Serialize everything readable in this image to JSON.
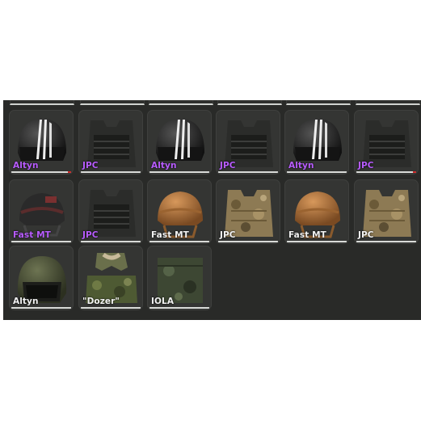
{
  "colors": {
    "rarity_purple": "#b85cff",
    "rarity_white": "#f2f2f2",
    "panel_bg": "#292a28",
    "slot_bg": "#343533"
  },
  "inventory": {
    "rows": [
      [
        {
          "label": "Altyn",
          "icon": "altyn-helmet-striped-icon",
          "rarity": "purple",
          "damaged": true
        },
        {
          "label": "JPC",
          "icon": "jpc-plate-carrier-black-icon",
          "rarity": "purple",
          "damaged": false
        },
        {
          "label": "Altyn",
          "icon": "altyn-helmet-striped-icon",
          "rarity": "purple",
          "damaged": false
        },
        {
          "label": "JPC",
          "icon": "jpc-plate-carrier-black-icon",
          "rarity": "purple",
          "damaged": false
        },
        {
          "label": "Altyn",
          "icon": "altyn-helmet-striped-icon",
          "rarity": "purple",
          "damaged": false
        },
        {
          "label": "JPC",
          "icon": "jpc-plate-carrier-black-icon",
          "rarity": "purple",
          "damaged": true
        }
      ],
      [
        {
          "label": "Fast MT",
          "icon": "fast-mt-helmet-black-icon",
          "rarity": "purple",
          "damaged": false
        },
        {
          "label": "JPC",
          "icon": "jpc-plate-carrier-black-icon",
          "rarity": "purple",
          "damaged": false
        },
        {
          "label": "Fast MT",
          "icon": "fast-mt-helmet-tan-icon",
          "rarity": "white",
          "damaged": false
        },
        {
          "label": "JPC",
          "icon": "jpc-plate-carrier-multicam-icon",
          "rarity": "white",
          "damaged": false
        },
        {
          "label": "Fast MT",
          "icon": "fast-mt-helmet-tan-icon",
          "rarity": "white",
          "damaged": false
        },
        {
          "label": "JPC",
          "icon": "jpc-plate-carrier-multicam-icon",
          "rarity": "white",
          "damaged": false
        }
      ],
      [
        {
          "label": "Altyn",
          "icon": "altyn-helmet-olive-icon",
          "rarity": "white",
          "damaged": false
        },
        {
          "label": "\"Dozer\"",
          "icon": "dozer-pants-icon",
          "rarity": "white",
          "damaged": false
        },
        {
          "label": "IOLA",
          "icon": "iola-pouch-icon",
          "rarity": "white",
          "damaged": false
        }
      ]
    ]
  }
}
